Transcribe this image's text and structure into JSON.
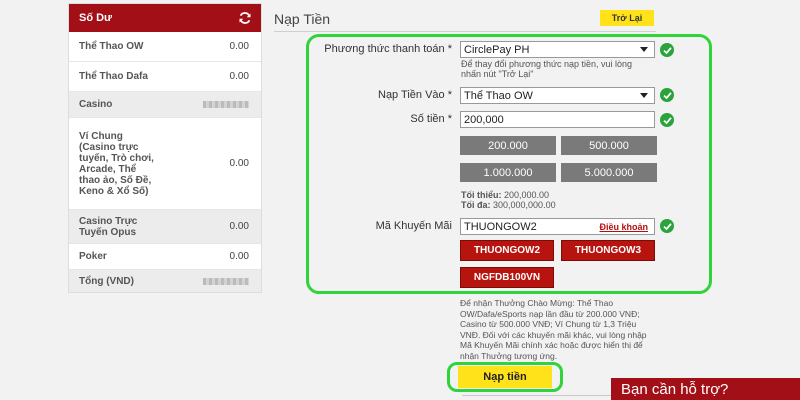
{
  "balance": {
    "header": "Số Dư",
    "rows": [
      {
        "name": "Thể Thao OW",
        "value": "0.00"
      },
      {
        "name": "Thể Thao Dafa",
        "value": "0.00"
      },
      {
        "name": "Casino",
        "value": ""
      },
      {
        "name": "Ví Chung (Casino trực tuyến, Trò chơi, Arcade, Thể thao ảo, Số Đề, Keno & Xổ Số)",
        "value": "0.00"
      },
      {
        "name": "Casino Trực Tuyến Opus",
        "value": "0.00"
      },
      {
        "name": "Poker",
        "value": "0.00"
      },
      {
        "name": "Tổng (VND)",
        "value": ""
      }
    ]
  },
  "page": {
    "title": "Nạp Tiền",
    "back_label": "Trở Lại"
  },
  "form": {
    "method_label": "Phương thức thanh toán *",
    "method_value": "CirclePay PH",
    "method_note_1": "Để thay đổi phương thức nạp tiền, vui lòng",
    "method_note_2": "nhấn nút \"Trở Lại\"",
    "deposit_to_label": "Nạp Tiền Vào *",
    "deposit_to_value": "Thể Thao OW",
    "amount_label": "Số tiền *",
    "amount_value": "200,000",
    "quick_amounts": [
      "200.000",
      "500.000",
      "1.000.000",
      "5.000.000"
    ],
    "min_label": "Tối thiểu:",
    "min_value": "200,000.00",
    "max_label": "Tối đa:",
    "max_value": "300,000,000.00",
    "promo_label": "Mã Khuyến Mãi",
    "promo_value": "THUONGOW2",
    "terms_label": "Điều khoản",
    "promo_codes": [
      "THUONGOW2",
      "THUONGOW3",
      "NGFDB100VN"
    ]
  },
  "bottom_note": "Để nhận Thưởng Chào Mừng: Thể Thao OW/Dafa/eSports nạp lần đầu từ 200.000 VNĐ; Casino từ 500.000 VNĐ; Ví Chung từ 1,3 Triệu VNĐ. Đối với các khuyến mãi khác, vui lòng nhập Mã Khuyến Mãi chính xác hoặc được hiển thị để nhận Thưởng tương ứng.",
  "submit_label": "Nạp tiền",
  "help_label": "Bạn cần hỗ trợ?",
  "colors": {
    "brand_red": "#a30f17",
    "accent_yellow": "#ffe21a",
    "highlight_green": "#2fd33a",
    "check_green": "#2aa33b"
  }
}
